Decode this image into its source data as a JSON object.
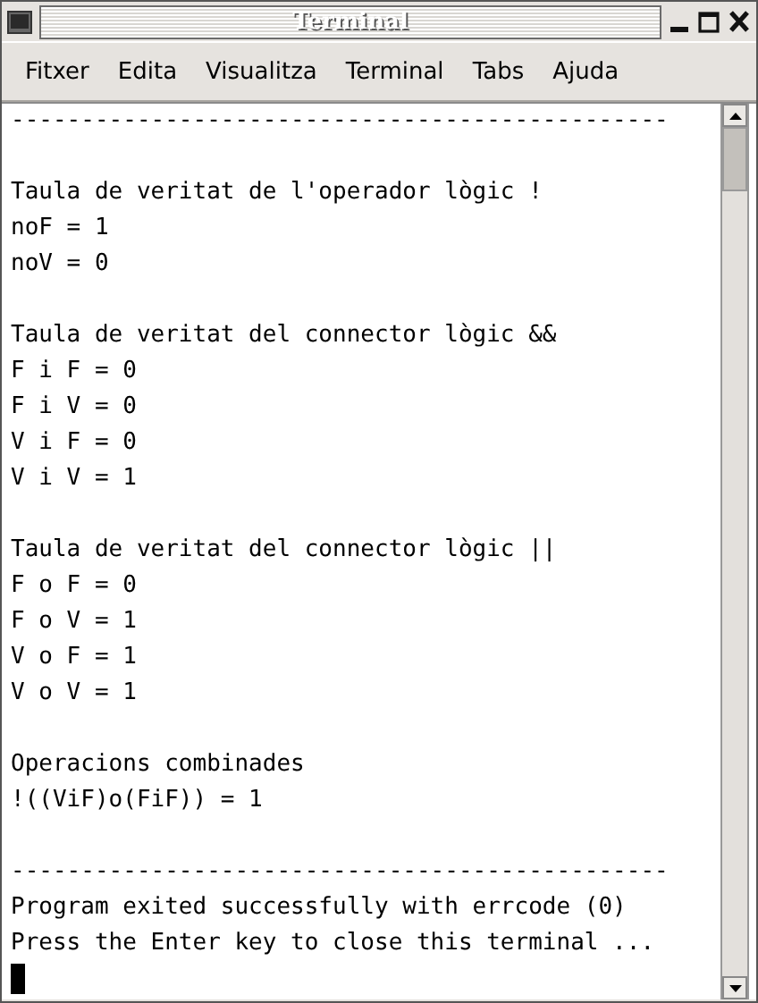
{
  "window": {
    "title": "Terminal"
  },
  "menu": [
    "Fitxer",
    "Edita",
    "Visualitza",
    "Terminal",
    "Tabs",
    "Ajuda"
  ],
  "terminal": {
    "blocks": [
      [
        "-----------------------------------------------"
      ],
      [
        "Taula de veritat de l'operador lògic !",
        "noF = 1",
        "noV = 0"
      ],
      [
        "Taula de veritat del connector lògic &&",
        "F i F = 0",
        "F i V = 0",
        "V i F = 0",
        "V i V = 1"
      ],
      [
        "Taula de veritat del connector lògic ||",
        "F o F = 0",
        "F o V = 1",
        "V o F = 1",
        "V o V = 1"
      ],
      [
        "Operacions combinades",
        "!((ViF)o(FiF)) = 1"
      ],
      [
        "-----------------------------------------------",
        "Program exited successfully with errcode (0)",
        "Press the Enter key to close this terminal ..."
      ]
    ],
    "cursor_visible": true
  }
}
